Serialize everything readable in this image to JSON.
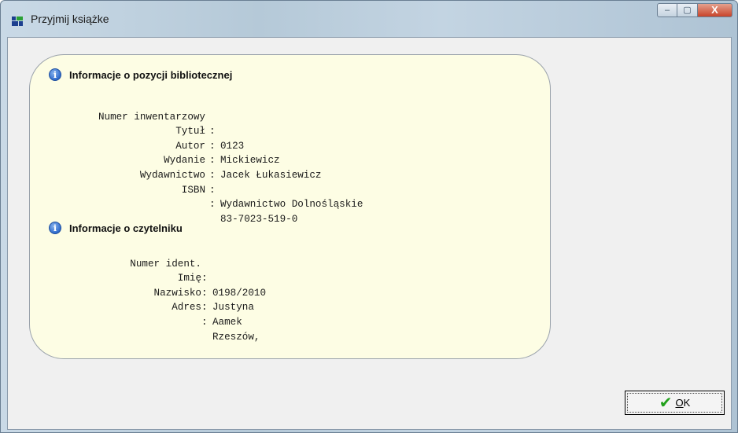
{
  "window": {
    "title": "Przyjmij książke",
    "buttons": {
      "minimize": "–",
      "maximize": "▢",
      "close": "X"
    }
  },
  "book_section": {
    "title": "Informacje o pozycji bibliotecznej",
    "rows": [
      {
        "label": "Numer inwentarzowy",
        "value": "0123"
      },
      {
        "label": "Tytuł",
        "value": "Mickiewicz"
      },
      {
        "label": "Autor",
        "value": "Jacek Łukasiewicz"
      },
      {
        "label": "Wydanie",
        "value": ""
      },
      {
        "label": "Wydawnictwo",
        "value": "Wydawnictwo Dolnośląskie"
      },
      {
        "label": "ISBN",
        "value": "83-7023-519-0"
      }
    ]
  },
  "reader_section": {
    "title": "Informacje o czytelniku",
    "rows": [
      {
        "label": "Numer ident.",
        "value": "0198/2010"
      },
      {
        "label": "Imię",
        "value": "Justyna"
      },
      {
        "label": "Nazwisko",
        "value": "Aamek"
      },
      {
        "label": "Adres",
        "value": "Rzeszów,"
      }
    ]
  },
  "ok_button": {
    "label": "OK",
    "icon": "checkmark-icon"
  },
  "colors": {
    "panel_bg": "#fdfde4",
    "info_icon": "#2f6bcc",
    "check": "#22a11c",
    "close_button": "#c8442a"
  }
}
